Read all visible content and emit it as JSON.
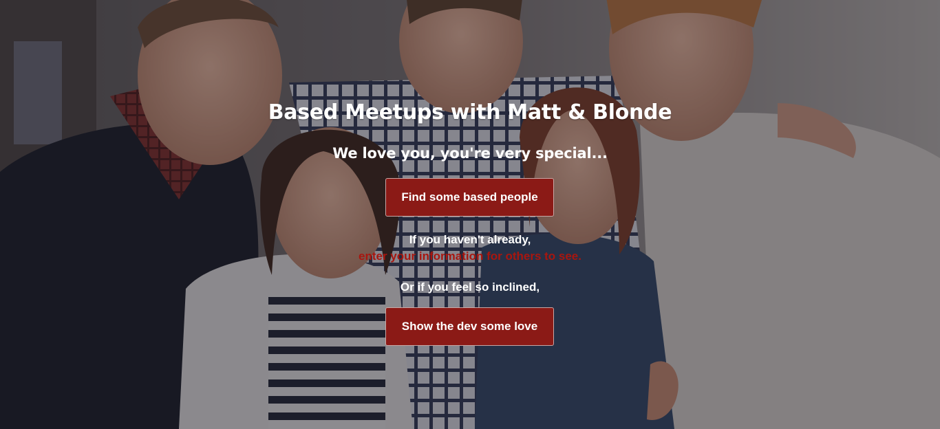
{
  "hero": {
    "title": "Based Meetups with Matt & Blonde",
    "subtitle": "We love you, you're very special...",
    "find_button_label": "Find some based people",
    "already_text": "If you haven't already,",
    "info_link_text": "enter your information for others to see.",
    "inclined_text": "Or if you feel so inclined,",
    "love_button_label": "Show the dev some love"
  },
  "colors": {
    "button_background": "#8b1a16",
    "link_text": "#a8160f",
    "overlay": "#1c1a22"
  },
  "background": {
    "image": "group-selfie-photo"
  }
}
